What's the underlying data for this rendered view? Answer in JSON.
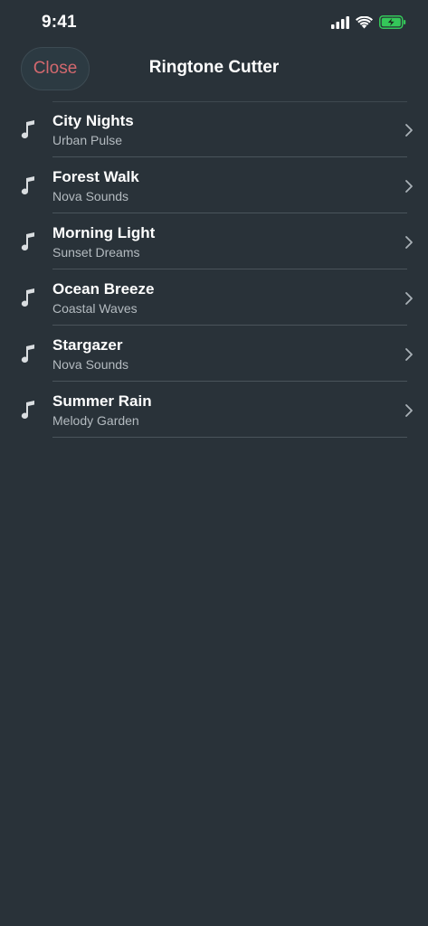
{
  "status_bar": {
    "time": "9:41",
    "icons": [
      "cellular-signal-icon",
      "wifi-icon",
      "battery-charging-icon"
    ],
    "battery_color": "#34c759"
  },
  "header": {
    "close_label": "Close",
    "title": "Ringtone Cutter",
    "close_color": "#d2686e"
  },
  "songs": [
    {
      "title": "City Nights",
      "artist": "Urban Pulse"
    },
    {
      "title": "Forest Walk",
      "artist": "Nova Sounds"
    },
    {
      "title": "Morning Light",
      "artist": "Sunset Dreams"
    },
    {
      "title": "Ocean Breeze",
      "artist": "Coastal Waves"
    },
    {
      "title": "Stargazer",
      "artist": "Nova Sounds"
    },
    {
      "title": "Summer Rain",
      "artist": "Melody Garden"
    }
  ],
  "item_icon": "music-note-icon",
  "item_action_icon": "chevron-right-icon"
}
